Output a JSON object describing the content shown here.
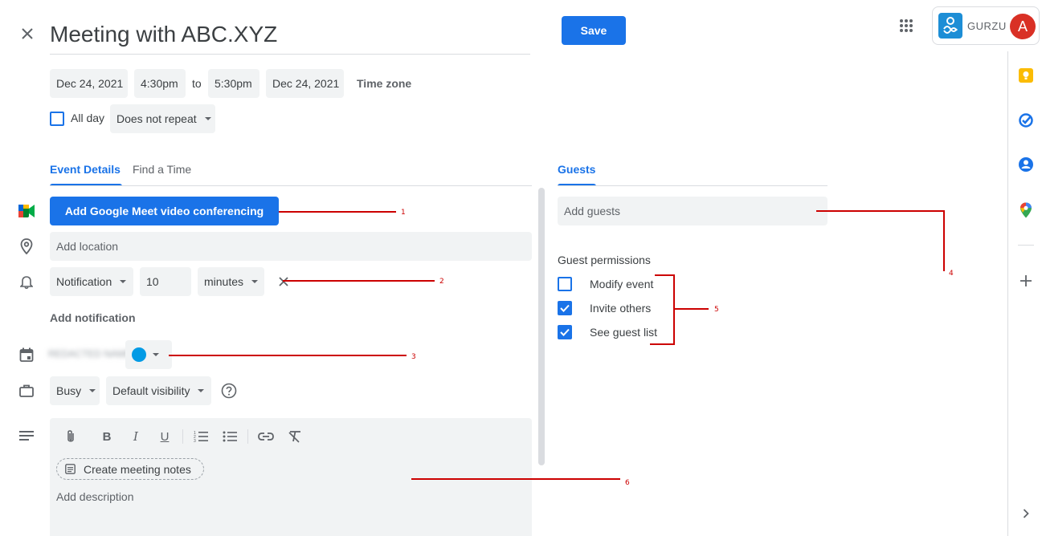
{
  "header": {
    "title": "Meeting with ABC.XYZ",
    "save_label": "Save",
    "brand": "GURZU",
    "avatar_letter": "A"
  },
  "datetime": {
    "start_date": "Dec 24, 2021",
    "start_time": "4:30pm",
    "to": "to",
    "end_time": "5:30pm",
    "end_date": "Dec 24, 2021",
    "timezone": "Time zone",
    "all_day": "All day",
    "repeat": "Does not repeat"
  },
  "tabs": {
    "event_details": "Event Details",
    "find_time": "Find a Time",
    "guests": "Guests"
  },
  "details": {
    "meet_button": "Add Google Meet video conferencing",
    "location_placeholder": "Add location",
    "notification_type": "Notification",
    "notification_value": "10",
    "notification_unit": "minutes",
    "add_notification": "Add notification",
    "calendar_name": "REDACTED NAME",
    "status": "Busy",
    "visibility": "Default visibility",
    "create_notes": "Create meeting notes",
    "description_placeholder": "Add description"
  },
  "guests": {
    "placeholder": "Add guests",
    "permissions_title": "Guest permissions",
    "permissions": [
      {
        "label": "Modify event",
        "checked": false
      },
      {
        "label": "Invite others",
        "checked": true
      },
      {
        "label": "See guest list",
        "checked": true
      }
    ]
  },
  "annotations": [
    "1",
    "2",
    "3",
    "4",
    "5",
    "6"
  ],
  "colors": {
    "accent": "#1a73e8",
    "chip_bg": "#f1f3f4",
    "annotation_red": "#cc0000",
    "event_color": "#039be5",
    "avatar_bg": "#d93025"
  }
}
